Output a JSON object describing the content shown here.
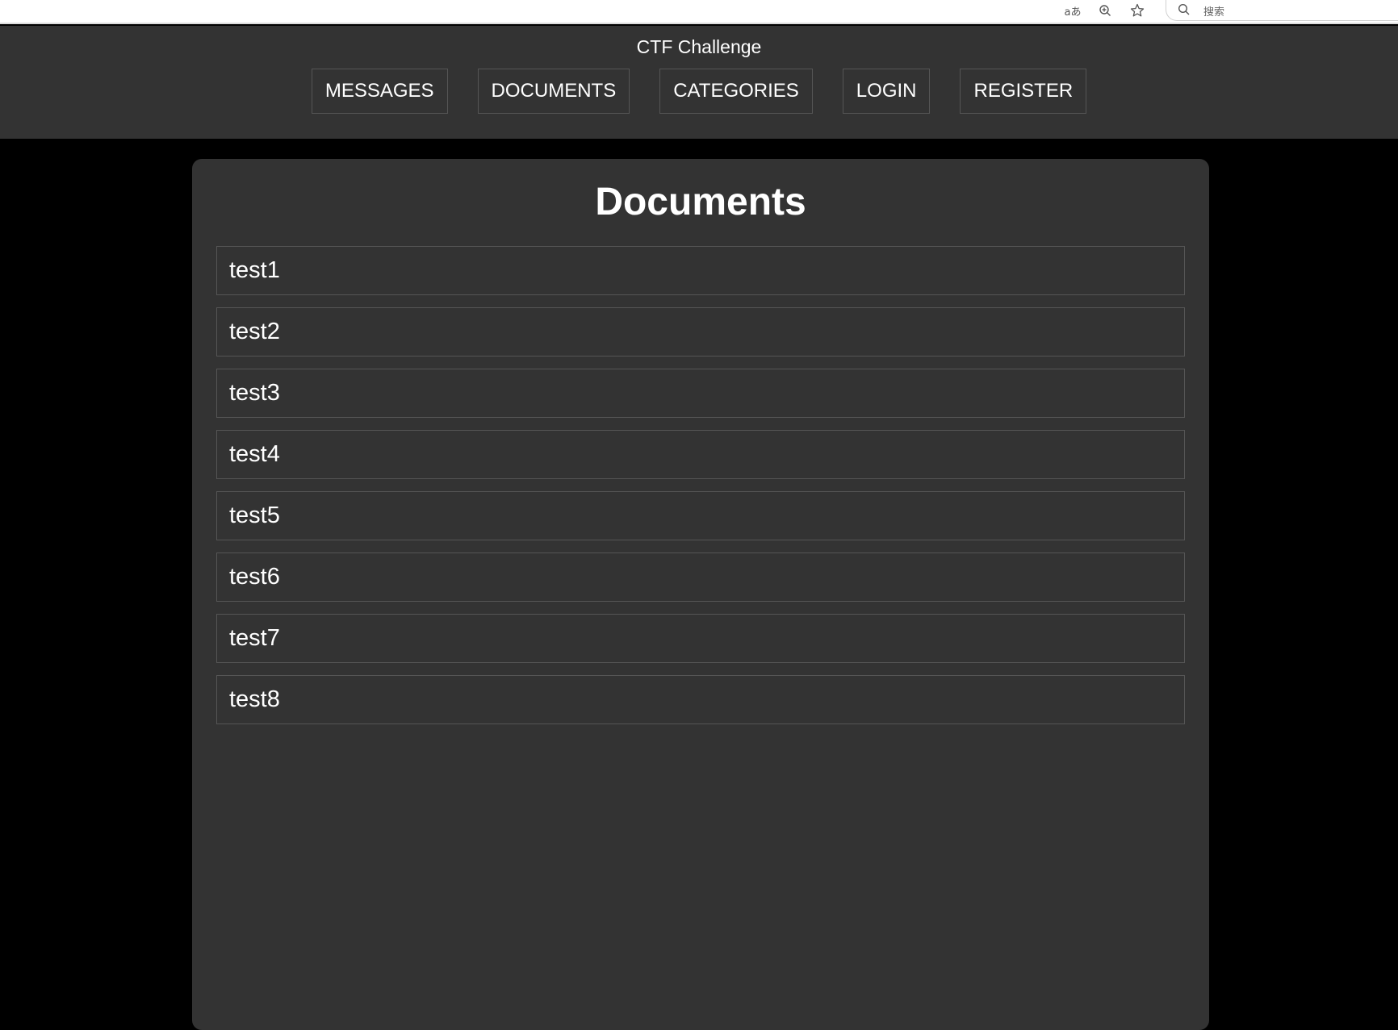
{
  "browser": {
    "icons": [
      "translate-icon",
      "zoom-icon",
      "star-icon"
    ],
    "search_placeholder": "搜索"
  },
  "header": {
    "title": "CTF Challenge",
    "nav": [
      {
        "label": "MESSAGES"
      },
      {
        "label": "DOCUMENTS"
      },
      {
        "label": "CATEGORIES"
      },
      {
        "label": "LOGIN"
      },
      {
        "label": "REGISTER"
      }
    ]
  },
  "main": {
    "title": "Documents",
    "documents": [
      {
        "name": "test1"
      },
      {
        "name": "test2"
      },
      {
        "name": "test3"
      },
      {
        "name": "test4"
      },
      {
        "name": "test5"
      },
      {
        "name": "test6"
      },
      {
        "name": "test7"
      },
      {
        "name": "test8"
      }
    ]
  },
  "colors": {
    "page_bg": "#000000",
    "panel_bg": "#333333",
    "text": "#ffffff",
    "border": "#555555"
  }
}
